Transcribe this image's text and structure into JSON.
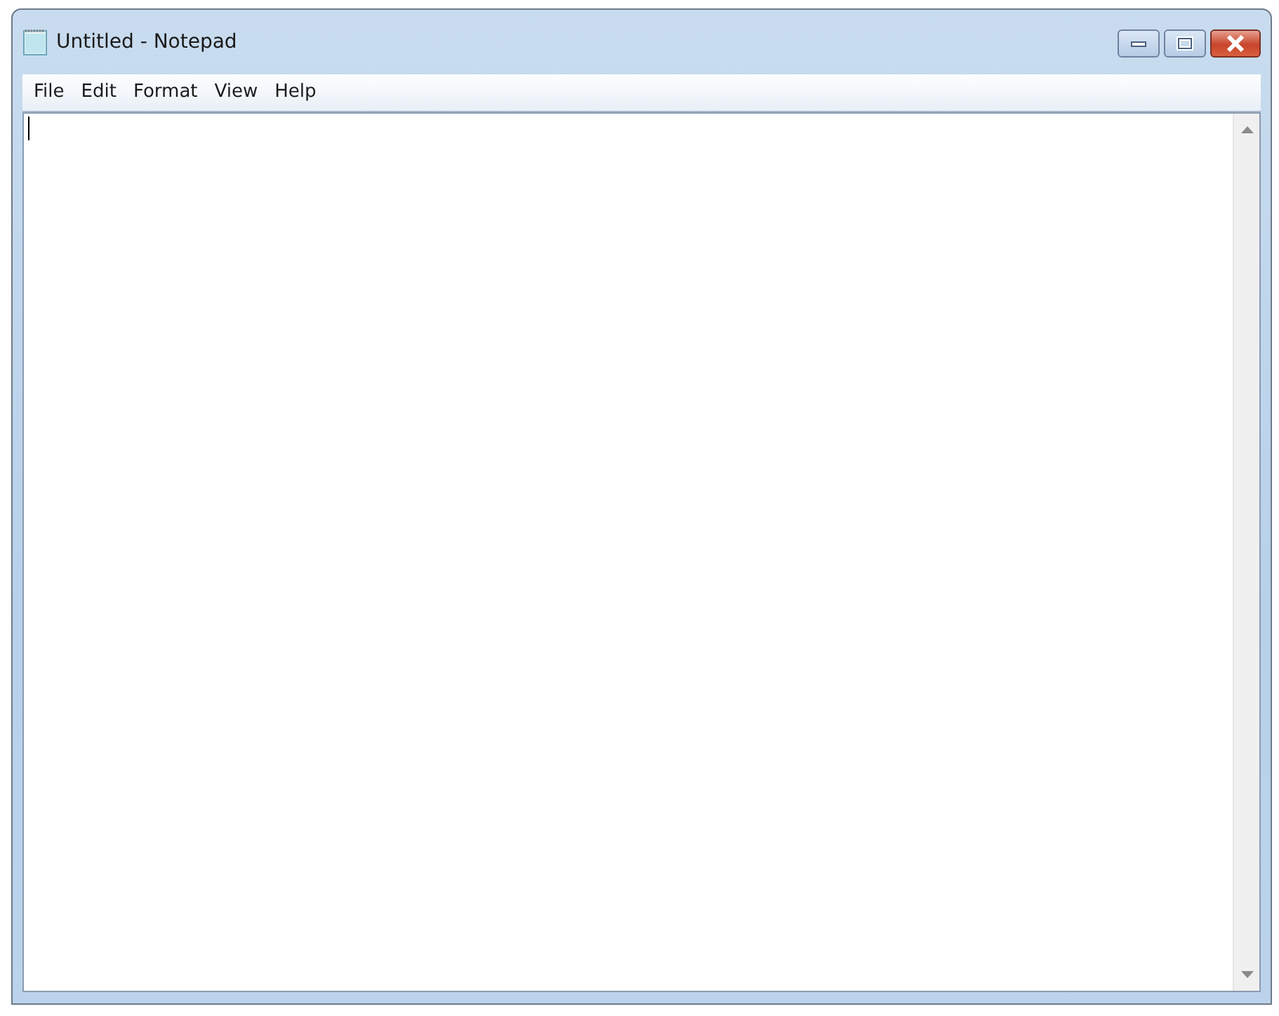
{
  "window": {
    "title": "Untitled - Notepad"
  },
  "menu": [
    {
      "label": "File"
    },
    {
      "label": "Edit"
    },
    {
      "label": "Format"
    },
    {
      "label": "View"
    },
    {
      "label": "Help"
    }
  ]
}
